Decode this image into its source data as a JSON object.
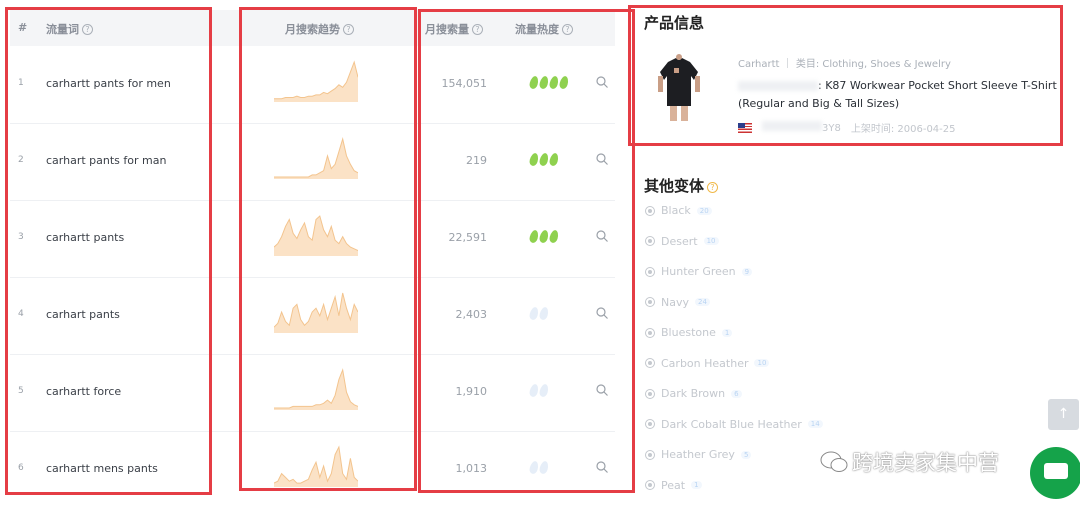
{
  "table": {
    "headers": {
      "rank": "#",
      "keyword": "流量词",
      "trend": "月搜索趋势",
      "volume": "月搜索量",
      "heat": "流量热度",
      "help_glyph": "?"
    },
    "rows": [
      {
        "rank": "1",
        "keyword": "carhartt pants for men",
        "volume": "154,051",
        "heat": 4,
        "heat_faint": false,
        "trend": [
          1,
          1,
          1,
          2,
          2,
          2,
          3,
          2,
          2,
          3,
          3,
          4,
          4,
          6,
          5,
          7,
          9,
          12,
          10,
          14,
          22,
          30,
          18
        ]
      },
      {
        "rank": "2",
        "keyword": "carhart pants for man",
        "volume": "219",
        "heat": 3,
        "heat_faint": false,
        "trend": [
          0,
          0,
          0,
          0,
          0,
          0,
          0,
          0,
          0,
          0,
          1,
          1,
          2,
          3,
          10,
          4,
          6,
          12,
          18,
          10,
          6,
          3,
          2
        ]
      },
      {
        "rank": "3",
        "keyword": "carhartt pants",
        "volume": "22,591",
        "heat": 3,
        "heat_faint": false,
        "trend": [
          4,
          6,
          10,
          16,
          20,
          12,
          9,
          14,
          18,
          10,
          8,
          20,
          22,
          14,
          10,
          16,
          8,
          6,
          10,
          6,
          4,
          3,
          2
        ]
      },
      {
        "rank": "4",
        "keyword": "carhart pants",
        "volume": "2,403",
        "heat": 0,
        "heat_faint": true,
        "trend": [
          2,
          4,
          10,
          5,
          3,
          12,
          14,
          6,
          3,
          5,
          10,
          12,
          8,
          14,
          6,
          12,
          18,
          8,
          20,
          12,
          6,
          14,
          10
        ]
      },
      {
        "rank": "5",
        "keyword": "carhartt force",
        "volume": "1,910",
        "heat": 0,
        "heat_faint": true,
        "trend": [
          0,
          0,
          0,
          0,
          0,
          1,
          1,
          1,
          1,
          1,
          1,
          2,
          2,
          3,
          5,
          3,
          8,
          18,
          24,
          10,
          4,
          2,
          1
        ]
      },
      {
        "rank": "6",
        "keyword": "carhartt mens pants",
        "volume": "1,013",
        "heat": 0,
        "heat_faint": true,
        "trend": [
          1,
          2,
          6,
          4,
          2,
          3,
          1,
          1,
          2,
          3,
          8,
          12,
          4,
          10,
          2,
          6,
          16,
          20,
          6,
          3,
          14,
          4,
          2
        ]
      }
    ]
  },
  "product_info": {
    "title": "产品信息",
    "brand_line": "Carhartt ｜ 类目: Clothing, Shoes & Jewelry",
    "product_title": ": K87 Workwear Pocket Short Sleeve T-Shirt (Regular and Big & Tall Sizes)",
    "asin_suffix": "3Y8",
    "listed_date": "上架时间: 2006-04-25"
  },
  "variants": {
    "title": "其他变体",
    "items": [
      {
        "name": "Black",
        "count": "20"
      },
      {
        "name": "Desert",
        "count": "10"
      },
      {
        "name": "Hunter Green",
        "count": "9"
      },
      {
        "name": "Navy",
        "count": "24"
      },
      {
        "name": "Bluestone",
        "count": "1"
      },
      {
        "name": "Carbon Heather",
        "count": "10"
      },
      {
        "name": "Dark Brown",
        "count": "6"
      },
      {
        "name": "Dark Cobalt Blue Heather",
        "count": "14"
      },
      {
        "name": "Heather Grey",
        "count": "5"
      },
      {
        "name": "Peat",
        "count": "1"
      }
    ]
  },
  "watermark": {
    "text": "跨境卖家集中营"
  },
  "colors": {
    "highlight": "#e53d45",
    "heat_green": "#8fd14f",
    "spark_fill": "#fbe2c6",
    "spark_line": "#f3c48e"
  },
  "icons": {
    "back_to_top": "arrow-up-icon",
    "chat": "chat-bubble-icon",
    "search": "magnifier-icon"
  }
}
